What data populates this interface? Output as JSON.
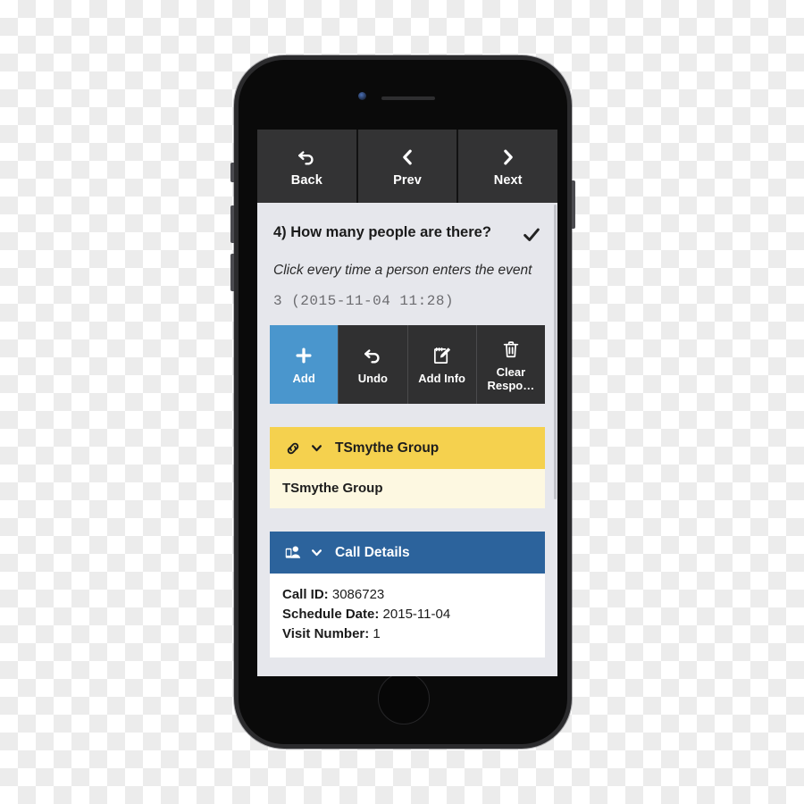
{
  "device": {
    "frame": "iphone",
    "camera_icon": "front-camera",
    "speaker_icon": "earpiece-speaker",
    "home_button": "home-button"
  },
  "navbar": {
    "buttons": [
      {
        "label": "Back",
        "icon": "undo-arrow-icon"
      },
      {
        "label": "Prev",
        "icon": "chevron-left-icon"
      },
      {
        "label": "Next",
        "icon": "chevron-right-icon"
      }
    ]
  },
  "question": {
    "title": "4) How many people are there?",
    "complete_icon": "checkmark-icon",
    "instruction": "Click every time a person enters the event",
    "answer": "3 (2015-11-04 11:28)"
  },
  "actions": [
    {
      "label": "Add",
      "icon": "plus-icon",
      "accent": "#4a96cd"
    },
    {
      "label": "Undo",
      "icon": "undo-arrow-icon",
      "accent": "#303031"
    },
    {
      "label": "Add Info",
      "icon": "note-pencil-icon",
      "accent": "#303031"
    },
    {
      "label": "Clear Respo…",
      "icon": "trash-icon",
      "accent": "#303031"
    }
  ],
  "panels": {
    "group": {
      "header_title": "TSmythe Group",
      "header_icon": "chain-link-icon",
      "caret_icon": "chevron-down-icon",
      "header_color": "#f5d14e",
      "body_text": "TSmythe Group",
      "body_color": "#fdf8e1"
    },
    "call_details": {
      "header_title": "Call Details",
      "header_icon": "phone-person-icon",
      "caret_icon": "chevron-down-icon",
      "header_color": "#2c639c",
      "rows": [
        {
          "key": "Call ID:",
          "value": "3086723"
        },
        {
          "key": "Schedule Date:",
          "value": "2015-11-04"
        },
        {
          "key": "Visit Number:",
          "value": "1"
        }
      ]
    }
  },
  "colors": {
    "screen_bg": "#e6e7ec",
    "toolbar_bg": "#333334",
    "primary_blue": "#4a96cd",
    "header_blue": "#2c639c",
    "header_yellow": "#f5d14e",
    "cream": "#fdf8e1"
  }
}
